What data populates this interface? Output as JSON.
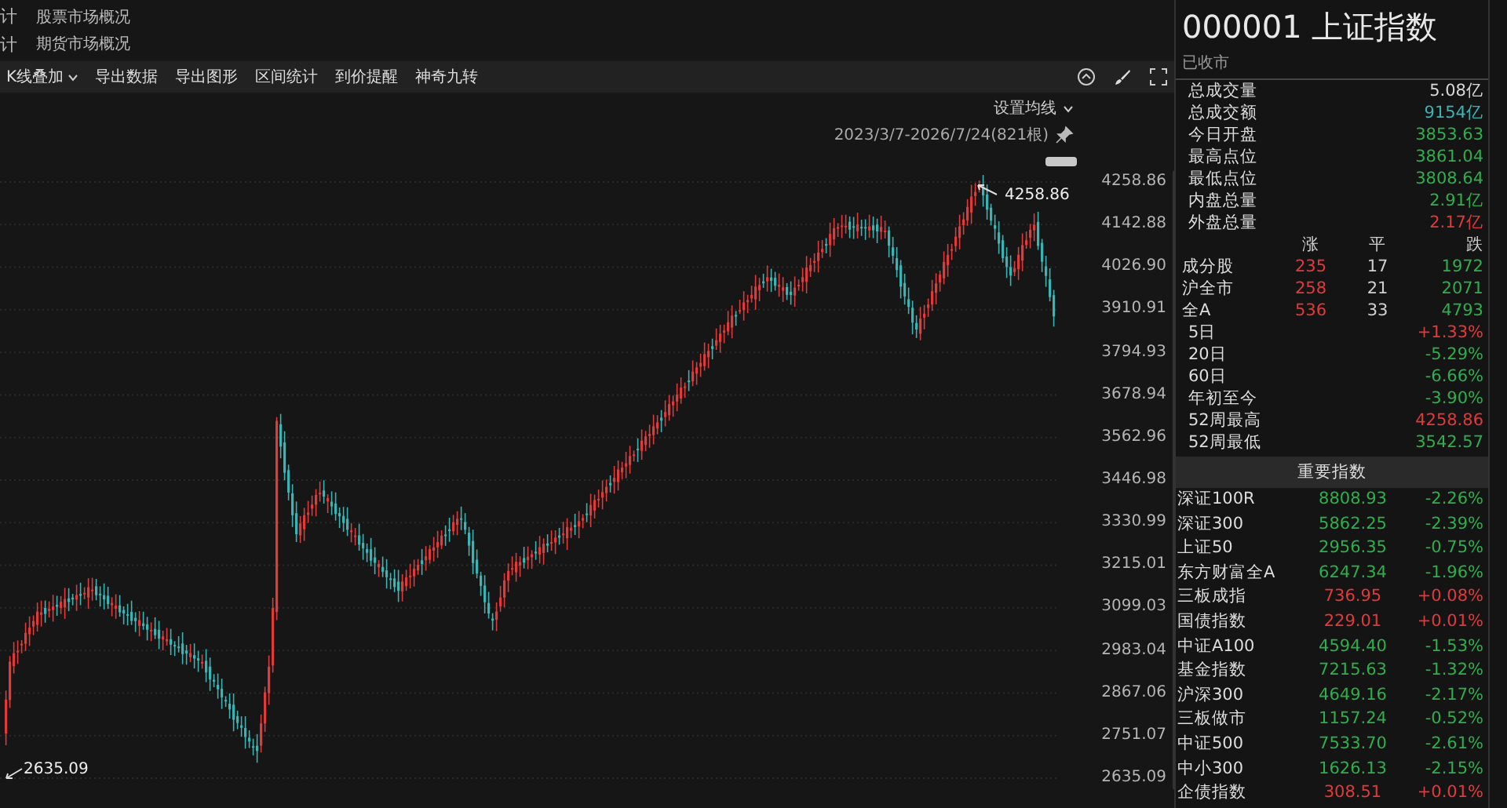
{
  "top_tabs": [
    {
      "label": "股票市场概况",
      "side": "计"
    },
    {
      "label": "期货市场概况",
      "side": "计"
    }
  ],
  "toolbar": {
    "items": [
      {
        "label": "K线叠加",
        "kind": "dropdown"
      },
      {
        "label": "导出数据",
        "kind": "plain"
      },
      {
        "label": "导出图形",
        "kind": "plain"
      },
      {
        "label": "区间统计",
        "kind": "plain"
      },
      {
        "label": "到价提醒",
        "kind": "plain"
      },
      {
        "label": "神奇九转",
        "kind": "plain"
      }
    ]
  },
  "chart": {
    "ma_setting": "设置均线",
    "range": "2023/3/7-2026/7/24(821根)",
    "high_label": "4258.86",
    "low_label": "2635.09",
    "yticks": [
      "4258.86",
      "4142.88",
      "4026.90",
      "3910.91",
      "3794.93",
      "3678.94",
      "3562.96",
      "3446.98",
      "3330.99",
      "3215.01",
      "3099.03",
      "2983.04",
      "2867.06",
      "2751.07",
      "2635.09"
    ]
  },
  "quote": {
    "title": "000001 上证指数",
    "status": "已收市",
    "stats": [
      {
        "label": "总成交量",
        "value": "5.08亿",
        "color": "#d8d8d8"
      },
      {
        "label": "总成交额",
        "value": "9154亿",
        "color": "#3cb4b4"
      },
      {
        "label": "今日开盘",
        "value": "3853.63",
        "color": "#2fae4c"
      },
      {
        "label": "最高点位",
        "value": "3861.04",
        "color": "#2fae4c"
      },
      {
        "label": "最低点位",
        "value": "3808.64",
        "color": "#2fae4c"
      },
      {
        "label": "内盘总量",
        "value": "2.91亿",
        "color": "#2fae4c"
      },
      {
        "label": "外盘总量",
        "value": "2.17亿",
        "color": "#e03a3a"
      }
    ],
    "breadth_header": [
      "涨",
      "平",
      "跌"
    ],
    "breadth": [
      {
        "label": "成分股",
        "up": "235",
        "flat": "17",
        "down": "1972"
      },
      {
        "label": "沪全市",
        "up": "258",
        "flat": "21",
        "down": "2071"
      },
      {
        "label": "全A",
        "up": "536",
        "flat": "33",
        "down": "4793"
      }
    ],
    "periods": [
      {
        "label": "5日",
        "value": "+1.33%",
        "color": "#e03a3a"
      },
      {
        "label": "20日",
        "value": "-5.29%",
        "color": "#2fae4c"
      },
      {
        "label": "60日",
        "value": "-6.66%",
        "color": "#2fae4c"
      },
      {
        "label": "年初至今",
        "value": "-3.90%",
        "color": "#2fae4c"
      },
      {
        "label": "52周最高",
        "value": "4258.86",
        "color": "#e03a3a"
      },
      {
        "label": "52周最低",
        "value": "3542.57",
        "color": "#2fae4c"
      }
    ]
  },
  "indices": {
    "title": "重要指数",
    "rows": [
      {
        "name": "深证100R",
        "price": "8808.93",
        "change": "-2.26%",
        "color": "#2fae4c"
      },
      {
        "name": "深证300",
        "price": "5862.25",
        "change": "-2.39%",
        "color": "#2fae4c"
      },
      {
        "name": "上证50",
        "price": "2956.35",
        "change": "-0.75%",
        "color": "#2fae4c"
      },
      {
        "name": "东方财富全A",
        "price": "6247.34",
        "change": "-1.96%",
        "color": "#2fae4c"
      },
      {
        "name": "三板成指",
        "price": "736.95",
        "change": "+0.08%",
        "color": "#e03a3a"
      },
      {
        "name": "国债指数",
        "price": "229.01",
        "change": "+0.01%",
        "color": "#e03a3a"
      },
      {
        "name": "中证A100",
        "price": "4594.40",
        "change": "-1.53%",
        "color": "#2fae4c"
      },
      {
        "name": "基金指数",
        "price": "7215.63",
        "change": "-1.32%",
        "color": "#2fae4c"
      },
      {
        "name": "沪深300",
        "price": "4649.16",
        "change": "-2.17%",
        "color": "#2fae4c"
      },
      {
        "name": "三板做市",
        "price": "1157.24",
        "change": "-0.52%",
        "color": "#2fae4c"
      },
      {
        "name": "中证500",
        "price": "7533.70",
        "change": "-2.61%",
        "color": "#2fae4c"
      },
      {
        "name": "中小300",
        "price": "1626.13",
        "change": "-2.15%",
        "color": "#2fae4c"
      },
      {
        "name": "企债指数",
        "price": "308.51",
        "change": "+0.01%",
        "color": "#e03a3a"
      }
    ]
  }
}
